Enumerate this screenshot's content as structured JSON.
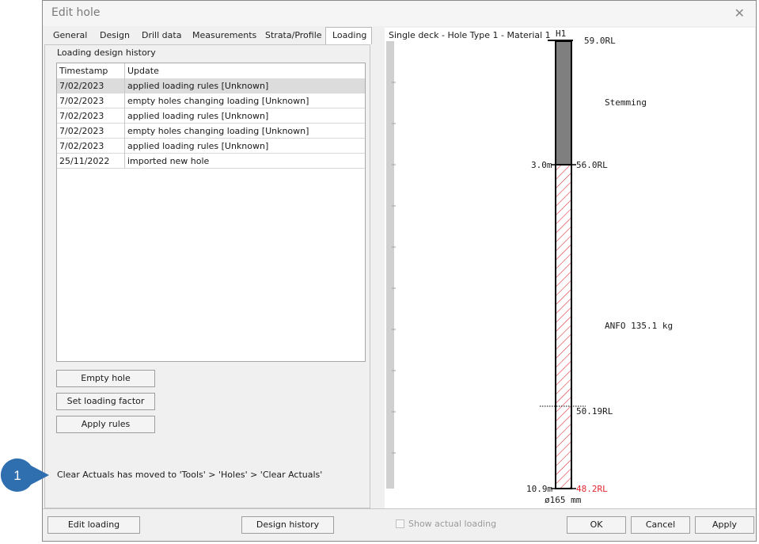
{
  "window": {
    "title": "Edit hole",
    "close": "✕"
  },
  "tabs": [
    {
      "label": "General"
    },
    {
      "label": "Design"
    },
    {
      "label": "Drill data"
    },
    {
      "label": "Measurements"
    },
    {
      "label": "Strata/Profile"
    },
    {
      "label": "Loading",
      "active": true
    }
  ],
  "history": {
    "title": "Loading design history",
    "columns": [
      "Timestamp",
      "Update"
    ],
    "rows": [
      {
        "timestamp": "7/02/2023",
        "update": "applied loading rules [Unknown]",
        "selected": true
      },
      {
        "timestamp": "7/02/2023",
        "update": "empty holes changing loading [Unknown]"
      },
      {
        "timestamp": "7/02/2023",
        "update": "applied loading rules [Unknown]"
      },
      {
        "timestamp": "7/02/2023",
        "update": "empty holes changing loading [Unknown]"
      },
      {
        "timestamp": "7/02/2023",
        "update": "applied loading rules [Unknown]"
      },
      {
        "timestamp": "25/11/2022",
        "update": " imported new hole"
      }
    ]
  },
  "actions": {
    "empty_hole": "Empty hole",
    "set_loading_factor": "Set loading factor",
    "apply_rules": "Apply rules"
  },
  "notice": "Clear Actuals has moved to 'Tools' > 'Holes' > 'Clear Actuals'",
  "callout": {
    "number": "1",
    "color": "#2f6fb0"
  },
  "diagram": {
    "title": "Single deck - Hole Type 1 - Material 1",
    "hole_name": "H1",
    "collar_rl": "59.0RL",
    "stemming_label": "Stemming",
    "stemming_depth": "3.0m",
    "stemming_base_rl": "56.0RL",
    "charge_label": "ANFO 135.1 kg",
    "marker_rl": "50.19RL",
    "toe_depth": "10.9m",
    "toe_rl": "48.2RL",
    "diameter": "ø165 mm",
    "stemming_color": "#7f7f7f",
    "charge_hatch_color": "#d9323a",
    "toe_rl_color": "#e0282e"
  },
  "footer": {
    "edit_loading": "Edit loading",
    "design_history": "Design history",
    "show_actual_loading": "Show actual loading",
    "ok": "OK",
    "cancel": "Cancel",
    "apply": "Apply"
  }
}
